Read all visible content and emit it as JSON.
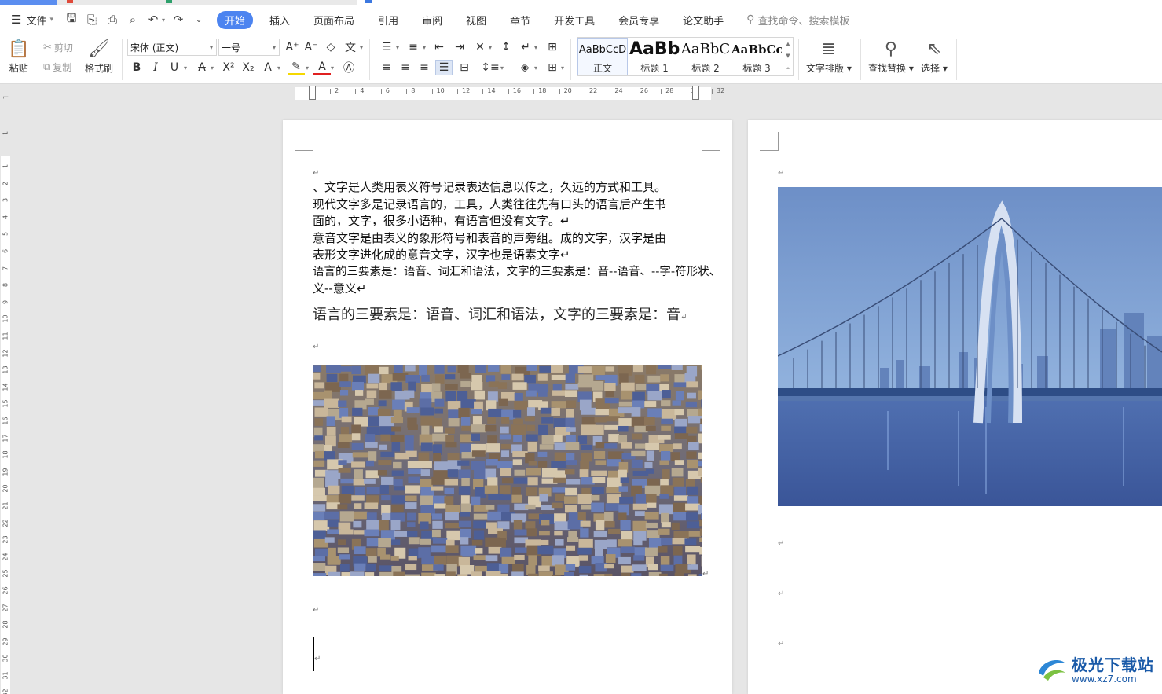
{
  "menubar": {
    "file_label": "文件",
    "tabs": [
      "开始",
      "插入",
      "页面布局",
      "引用",
      "审阅",
      "视图",
      "章节",
      "开发工具",
      "会员专享",
      "论文助手"
    ],
    "search_placeholder": "查找命令、搜索模板"
  },
  "ribbon": {
    "paste": "粘贴",
    "cut": "剪切",
    "copy": "复制",
    "format_painter": "格式刷",
    "font_name": "宋体 (正文)",
    "font_size": "一号",
    "styles": [
      {
        "preview": "AaBbCcD",
        "label": "正文"
      },
      {
        "preview": "AaBb",
        "label": "标题 1"
      },
      {
        "preview": "AaBbC",
        "label": "标题 2"
      },
      {
        "preview": "AaBbCcI",
        "label": "标题 3"
      }
    ],
    "text_layout": "文字排版",
    "find_replace": "查找替换",
    "select": "选择"
  },
  "ruler": {
    "h_ticks": [
      "2",
      "4",
      "6",
      "8",
      "10",
      "12",
      "14",
      "16",
      "18",
      "20",
      "22",
      "24",
      "26",
      "28",
      "30",
      "32"
    ],
    "v_ticks": [
      "1",
      "1",
      "2",
      "3",
      "4",
      "5",
      "6",
      "7",
      "8",
      "9",
      "10",
      "11",
      "12",
      "13",
      "14",
      "15",
      "16",
      "17",
      "18",
      "19",
      "20",
      "21",
      "22",
      "23",
      "24",
      "25",
      "26",
      "27",
      "28",
      "29",
      "30",
      "31",
      "32"
    ]
  },
  "document": {
    "lines": [
      "、文字是人类用表义符号记录表达信息以传之，久远的方式和工具。",
      "现代文字多是记录语言的，工具，人类往往先有口头的语言后产生书",
      "面的，文字，很多小语种，有语言但没有文字。↵",
      "意音文字是由表义的象形符号和表音的声旁组。成的文字，汉字是由",
      "表形文字进化成的意音文字，汉字也是语素文字↵",
      "语言的三要素是：语音、词汇和语法，文字的三要素是：音--语音、--字-符形状、",
      "义--意义↵"
    ],
    "serif_line": "语言的三要素是：语音、词汇和语法，文字的三要素是：音",
    "paragraph_mark": "↵"
  },
  "watermark": {
    "title": "极光下载站",
    "url": "www.xz7.com"
  }
}
